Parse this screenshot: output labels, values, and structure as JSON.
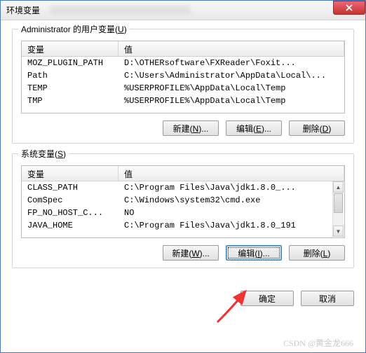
{
  "window": {
    "title": "环境变量",
    "close_icon": "close"
  },
  "user_group": {
    "legend_prefix": "Administrator 的用户变量(",
    "legend_hotkey": "U",
    "legend_suffix": ")",
    "header_var": "变量",
    "header_val": "值",
    "rows": [
      {
        "var": "MOZ_PLUGIN_PATH",
        "val": "D:\\OTHERsoftware\\FXReader\\Foxit..."
      },
      {
        "var": "Path",
        "val": "C:\\Users\\Administrator\\AppData\\Local\\..."
      },
      {
        "var": "TEMP",
        "val": "%USERPROFILE%\\AppData\\Local\\Temp"
      },
      {
        "var": "TMP",
        "val": "%USERPROFILE%\\AppData\\Local\\Temp"
      }
    ],
    "btn_new": "新建(N)...",
    "btn_edit": "编辑(E)...",
    "btn_del": "删除(D)"
  },
  "sys_group": {
    "legend_prefix": "系统变量(",
    "legend_hotkey": "S",
    "legend_suffix": ")",
    "header_var": "变量",
    "header_val": "值",
    "rows": [
      {
        "var": "CLASS_PATH",
        "val": "C:\\Program Files\\Java\\jdk1.8.0_..."
      },
      {
        "var": "ComSpec",
        "val": "C:\\Windows\\system32\\cmd.exe"
      },
      {
        "var": "FP_NO_HOST_C...",
        "val": "NO"
      },
      {
        "var": "JAVA_HOME",
        "val": "C:\\Program Files\\Java\\jdk1.8.0_191"
      }
    ],
    "btn_new": "新建(W)...",
    "btn_edit": "编辑(I)...",
    "btn_del": "删除(L)"
  },
  "footer": {
    "ok": "确定",
    "cancel": "取消"
  },
  "watermark": "CSDN @黄金龙666"
}
